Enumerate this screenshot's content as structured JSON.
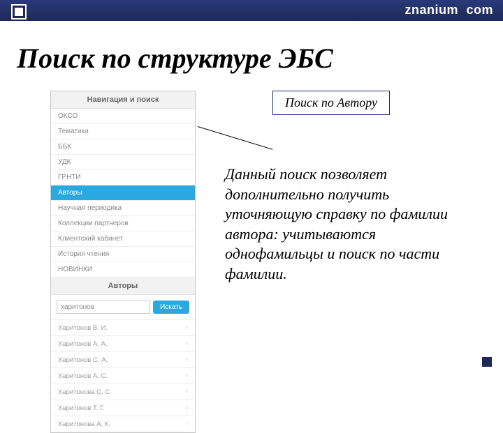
{
  "header": {
    "logo_part1": "znanium",
    "logo_sep": " ",
    "logo_part2": "com"
  },
  "slide": {
    "title": "Поиск по структуре ЭБС"
  },
  "nav": {
    "header": "Навигация и поиск",
    "items": [
      {
        "label": "ОКСО",
        "active": false
      },
      {
        "label": "Тематика",
        "active": false
      },
      {
        "label": "ББК",
        "active": false
      },
      {
        "label": "УДК",
        "active": false
      },
      {
        "label": "ГРНТИ",
        "active": false
      },
      {
        "label": "Авторы",
        "active": true
      },
      {
        "label": "Научная периодика",
        "active": false
      },
      {
        "label": "Коллекции партнеров",
        "active": false
      },
      {
        "label": "Клиентский кабинет",
        "active": false
      },
      {
        "label": "История чтения",
        "active": false
      },
      {
        "label": "НОВИНКИ",
        "active": false
      }
    ]
  },
  "authors_panel": {
    "header": "Авторы",
    "search_value": "харитонов",
    "search_button": "Искать",
    "results": [
      "Харитонов В. И.",
      "Харитонов А. А.",
      "Харитонов С. А.",
      "Харитонов А. С.",
      "Харитонова С. С.",
      "Харитонов Т. Г.",
      "Харитонова А. К."
    ]
  },
  "callout": {
    "label": "Поиск по Автору"
  },
  "description": {
    "text": "Данный поиск позволяет дополнительно получить уточняющую справку по фамилии автора: учитываются однофамильцы и поиск по части фамилии."
  }
}
